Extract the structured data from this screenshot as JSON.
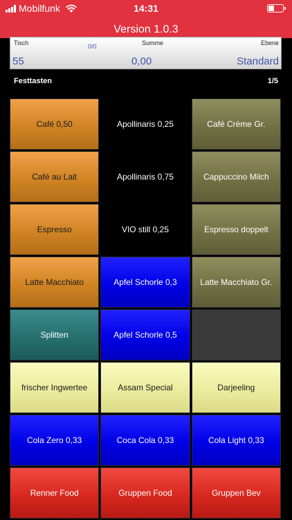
{
  "status_bar": {
    "carrier": "Mobilfunk",
    "time": "14:31",
    "battery_percent": 35
  },
  "header": {
    "version": "Version 1.0.3"
  },
  "info": {
    "tisch_label": "Tisch",
    "tisch_value": "55",
    "count": "0/0",
    "summe_label": "Summe",
    "summe_value": "0,00",
    "ebene_label": "Ebene",
    "ebene_value": "Standard"
  },
  "section": {
    "title": "Festtasten",
    "page": "1/5"
  },
  "colors": {
    "top_bar": "#e2313f",
    "orange": "#d08424",
    "olive": "#727145",
    "blue": "#0000e6",
    "teal": "#26706f",
    "cream": "#ecec9f",
    "red": "#d82820",
    "empty": "#3a3a3a",
    "value_text": "#4056a8"
  },
  "keys": [
    {
      "label": "Café 0,50",
      "color": "orange"
    },
    {
      "label": "Apollinaris 0,25",
      "color": "black"
    },
    {
      "label": "Café Crème Gr.",
      "color": "olive"
    },
    {
      "label": "Café au Lait",
      "color": "orange"
    },
    {
      "label": "Apollinaris 0,75",
      "color": "black"
    },
    {
      "label": "Cappuccino Milch",
      "color": "olive"
    },
    {
      "label": "Espresso",
      "color": "orange"
    },
    {
      "label": "VIO still 0,25",
      "color": "black"
    },
    {
      "label": "Espresso doppelt",
      "color": "olive"
    },
    {
      "label": "Latte Macchiato",
      "color": "orange"
    },
    {
      "label": "Apfel Schorle 0,3",
      "color": "blue"
    },
    {
      "label": "Latte Macchiato Gr.",
      "color": "olive"
    },
    {
      "label": "Splitten",
      "color": "teal"
    },
    {
      "label": "Apfel Schorle 0,5",
      "color": "blue"
    },
    {
      "label": "",
      "color": "empty"
    },
    {
      "label": "frischer Ingwertee",
      "color": "cream"
    },
    {
      "label": "Assam  Special",
      "color": "cream"
    },
    {
      "label": "Darjeeling",
      "color": "cream"
    },
    {
      "label": "Cola Zero 0,33",
      "color": "blue"
    },
    {
      "label": "Coca Cola 0,33",
      "color": "blue"
    },
    {
      "label": "Cola Light 0,33",
      "color": "blue"
    },
    {
      "label": "Renner Food",
      "color": "red"
    },
    {
      "label": "Gruppen Food",
      "color": "red"
    },
    {
      "label": "Gruppen Bev",
      "color": "red"
    }
  ]
}
